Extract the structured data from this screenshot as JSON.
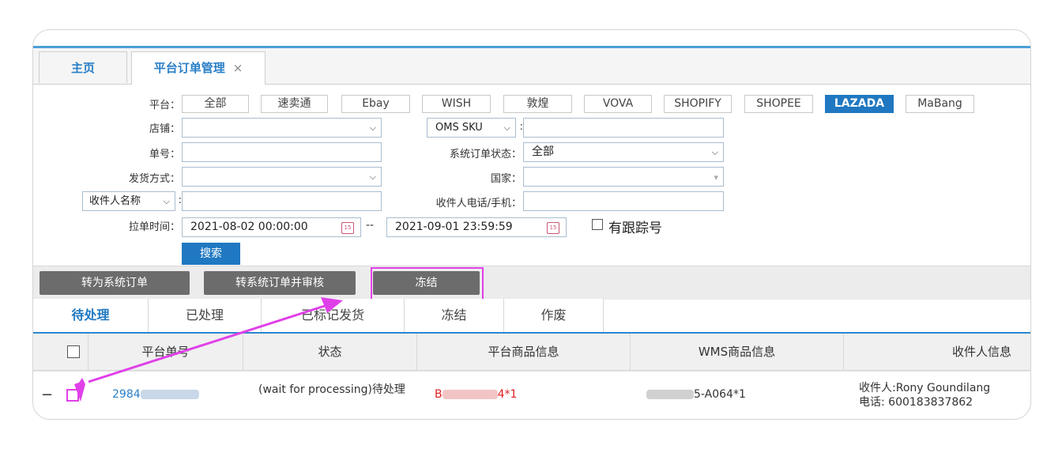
{
  "tabs": [
    {
      "label": "主页"
    },
    {
      "label": "平台订单管理",
      "close": "×"
    }
  ],
  "filters": {
    "platform_label": "平台：",
    "platforms": [
      "全部",
      "速卖通",
      "Ebay",
      "WISH",
      "敦煌",
      "VOVA",
      "SHOPIFY",
      "SHOPEE",
      "LAZADA",
      "MaBang"
    ],
    "selected_platform": "LAZADA",
    "store_label": "店铺：",
    "store_value": "",
    "order_no_label": "单号：",
    "order_no_value": "",
    "shipping_label": "发货方式：",
    "shipping_value": "",
    "recipient_select": "收件人名称",
    "recipient_value": "",
    "pull_time_label": "拉单时间：",
    "time_from": "2021-08-02 00:00:00",
    "time_sep": "--",
    "time_to": "2021-09-01 23:59:59",
    "tracking_checkbox_label": "有跟踪号",
    "sku_select": "OMS SKU",
    "sku_value": "",
    "system_status_label": "系统订单状态：",
    "system_status_value": "全部",
    "country_label": "国家：",
    "country_value": "",
    "phone_label": "收件人电话/手机：",
    "phone_value": "",
    "search_button": "搜索"
  },
  "actions": {
    "convert": "转为系统订单",
    "convert_review": "转系统订单并审核",
    "freeze": "冻结"
  },
  "status_tabs": [
    "待处理",
    "已处理",
    "已标记发货",
    "冻结",
    "作废"
  ],
  "active_status_tab": "待处理",
  "table": {
    "headers": [
      "平台单号",
      "状态",
      "平台商品信息",
      "WMS商品信息",
      "收件人信息"
    ],
    "rows": [
      {
        "expand": "−",
        "order_no_prefix": "2984",
        "status": "(wait for processing)待处理",
        "platform_item_prefix": "B",
        "platform_item_suffix": "4*1",
        "wms_item_suffix": "5-A064*1",
        "recipient_name": "收件人:Rony Goundilang",
        "recipient_phone": "电话: 600183837862"
      }
    ]
  },
  "colors": {
    "accent": "#1f78c1",
    "annotation": "#e040e8",
    "dark_button": "#6c6c6c"
  }
}
